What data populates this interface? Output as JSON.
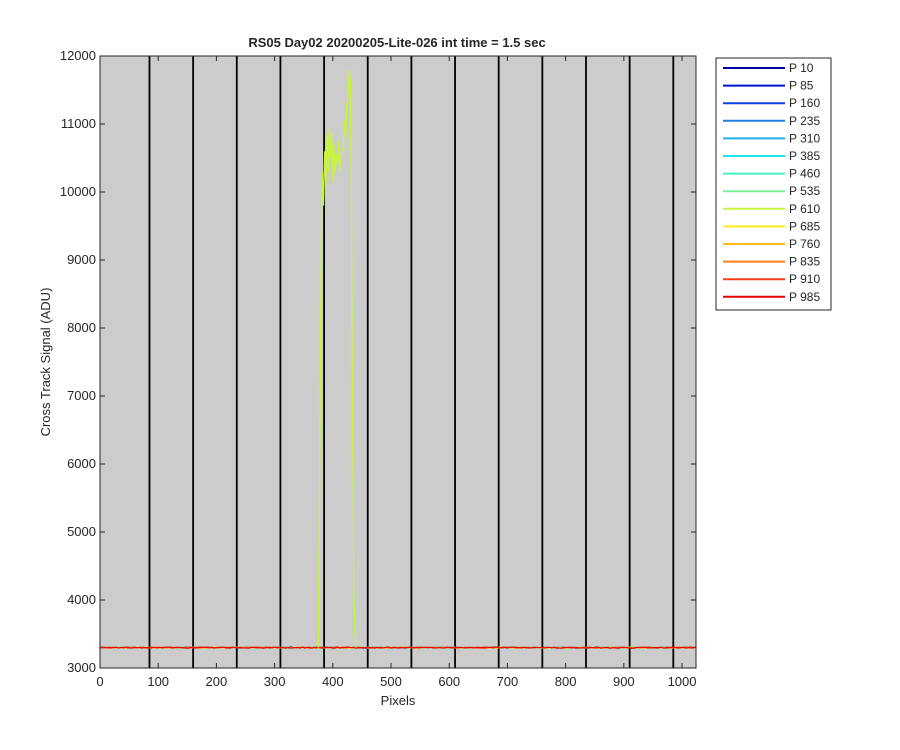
{
  "chart_data": {
    "type": "line",
    "title": "RS05 Day02 20200205-Lite-026 int time = 1.5 sec",
    "xlabel": "Pixels",
    "ylabel": "Cross Track Signal (ADU)",
    "xlim": [
      0,
      1024
    ],
    "ylim": [
      3000,
      12000
    ],
    "xticks": [
      0,
      100,
      200,
      300,
      400,
      500,
      600,
      700,
      800,
      900,
      1000
    ],
    "yticks": [
      3000,
      4000,
      5000,
      6000,
      7000,
      8000,
      9000,
      10000,
      11000,
      12000
    ],
    "vertical_lines_x": [
      85,
      160,
      235,
      310,
      385,
      460,
      535,
      610,
      685,
      760,
      835,
      910,
      985
    ],
    "grid": false,
    "background": "#cccccc",
    "legend_position": "outside-right-top",
    "baseline_level": 3300,
    "series": [
      {
        "name": "P 10",
        "color": "#0000a6"
      },
      {
        "name": "P 85",
        "color": "#0015cf"
      },
      {
        "name": "P 160",
        "color": "#0a43e6"
      },
      {
        "name": "P 235",
        "color": "#1f7fe0"
      },
      {
        "name": "P 310",
        "color": "#1fb2ea"
      },
      {
        "name": "P 385",
        "color": "#1fe2ee"
      },
      {
        "name": "P 460",
        "color": "#47f0c8"
      },
      {
        "name": "P 535",
        "color": "#7ef09a"
      },
      {
        "name": "P 610",
        "color": "#c8f53c",
        "peak": {
          "x": [
            375,
            378,
            380,
            382,
            384,
            386,
            388,
            390,
            392,
            394,
            396,
            398,
            400,
            402,
            404,
            406,
            408,
            410,
            412,
            414,
            416,
            418,
            420,
            422,
            424,
            426,
            428,
            430,
            432,
            434,
            436,
            438,
            440
          ],
          "y": [
            3300,
            6500,
            9300,
            10300,
            9800,
            10600,
            10100,
            10850,
            10300,
            10950,
            10500,
            10900,
            10150,
            10700,
            10250,
            10550,
            10400,
            10750,
            10300,
            10500,
            10650,
            10600,
            11050,
            10800,
            11300,
            11400,
            11800,
            11600,
            9900,
            6500,
            4200,
            3500,
            3300
          ]
        }
      },
      {
        "name": "P 685",
        "color": "#ffec1a"
      },
      {
        "name": "P 760",
        "color": "#ffb81a"
      },
      {
        "name": "P 835",
        "color": "#ff7a1a"
      },
      {
        "name": "P 910",
        "color": "#ff3d14"
      },
      {
        "name": "P 985",
        "color": "#e60000"
      }
    ]
  }
}
